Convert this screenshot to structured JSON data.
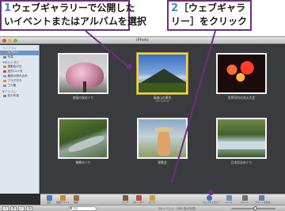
{
  "callouts": [
    {
      "number": "1",
      "line1": "ウェブギャラリーで公開した",
      "line2": "いイベントまたはアルバムを選択"
    },
    {
      "number": "2",
      "line1": "［ウェブギャラ",
      "line2": "リー］をクリック"
    }
  ],
  "window": {
    "title": "iPhoto"
  },
  "sidebar": {
    "heading_library": "ライブラリ",
    "library_items": [
      {
        "label": "イベント",
        "icon": "events-icon",
        "color": "#b88b3a"
      },
      {
        "label": "写真",
        "icon": "photos-icon",
        "color": "#5b87c5"
      }
    ],
    "heading_recent": "▼最近の項目",
    "recent_items": [
      {
        "label": "運動会の日",
        "icon": "event-icon",
        "color": "#b88b3a"
      },
      {
        "label": "過去12ヶ月",
        "icon": "calendar-icon",
        "color": "#cc4b3d"
      },
      {
        "label": "最後の読み込み",
        "icon": "import-icon",
        "color": "#7a9dcc"
      },
      {
        "label": "フラグ付き",
        "icon": "flag-icon",
        "color": "#e28a2e"
      },
      {
        "label": "ゴミ箱",
        "icon": "trash-icon",
        "color": "#8f8f8f"
      }
    ],
    "heading_albums": "▼アルバム",
    "album_items": [
      {
        "label": "花の写真",
        "icon": "album-icon",
        "color": "#5b87c5"
      }
    ]
  },
  "albums": [
    {
      "caption": "徳島の桜めぐり",
      "date": "",
      "photo": "sakura",
      "selected": false
    },
    {
      "caption": "高越山の景色",
      "date": "2007/03/17",
      "photo": "mountain",
      "selected": true
    },
    {
      "caption": "佐那河内の花火大会",
      "date": "",
      "photo": "fireworks",
      "selected": false
    },
    {
      "caption": "美郷めぐり",
      "date": "",
      "photo": "valley",
      "selected": false
    },
    {
      "caption": "運動会",
      "date": "",
      "photo": "boy",
      "selected": false
    },
    {
      "caption": "日本記念めぐり",
      "date": "",
      "photo": "gorge",
      "selected": false
    }
  ],
  "toolbar": {
    "left_tools": [
      {
        "label": "表示",
        "icon": "info-icon",
        "color": "#4a7cc4"
      },
      {
        "label": "新規イベント",
        "icon": "new-event-icon",
        "color": "#c98a2a"
      },
      {
        "label": "編集",
        "icon": "edit-icon",
        "color": "#9b6b3a"
      }
    ],
    "mid_tools": [
      {
        "label": "ブック",
        "icon": "book-icon",
        "color": "#7a5a3a"
      },
      {
        "label": "カレンダー",
        "icon": "calendar-tool-icon",
        "color": "#c94b3a"
      },
      {
        "label": "カード",
        "icon": "card-icon",
        "color": "#d59a3a"
      }
    ],
    "right_tools": [
      {
        "label": "ウェブギャラリー",
        "icon": "web-gallery-icon",
        "color": "#3d6fb8"
      },
      {
        "label": "メール",
        "icon": "mail-icon",
        "color": "#6e8fc0"
      },
      {
        "label": "プリント",
        "icon": "print-icon",
        "color": "#6f6f6f"
      },
      {
        "label": "プリントを注文",
        "icon": "order-prints-icon",
        "color": "#5f7fa8"
      }
    ]
  },
  "statusbar": {
    "buttons": [
      "+",
      "⚙",
      "↩",
      "⊞"
    ],
    "search_placeholder": "検索",
    "status": "26 イベント（283 枚の写真）",
    "zoom_level": 0.5
  }
}
